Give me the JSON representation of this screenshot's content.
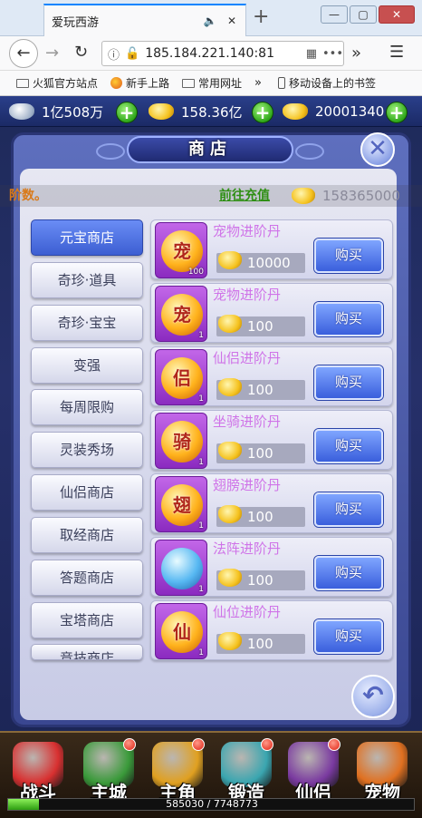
{
  "browser": {
    "tab_title": "爱玩西游",
    "url": "185.184.221.140:81",
    "bookmarks": [
      "火狐官方站点",
      "新手上路",
      "常用网址",
      "移动设备上的书签"
    ],
    "more_label": "»",
    "window_buttons": [
      "—",
      "▢",
      "✕"
    ]
  },
  "resources": [
    {
      "icon": "silver-ingot-icon",
      "value": "1亿508万"
    },
    {
      "icon": "gold-ingot-icon",
      "value": "158.36亿"
    },
    {
      "icon": "gold-ingot-pile-icon",
      "value": "20001340"
    }
  ],
  "shop": {
    "title": "商店",
    "notice": "阶数。",
    "recharge_link": "前往充值",
    "balance": "158365000"
  },
  "categories": [
    "元宝商店",
    "奇珍·道具",
    "奇珍·宝宝",
    "变强",
    "每周限购",
    "灵装秀场",
    "仙侣商店",
    "取经商店",
    "答题商店",
    "宝塔商店",
    "竞技商店"
  ],
  "active_category": 0,
  "items": [
    {
      "name": "宠物进阶丹",
      "glyph": "宠",
      "qty": "100",
      "price": "10000",
      "buy": "购买"
    },
    {
      "name": "宠物进阶丹",
      "glyph": "宠",
      "qty": "1",
      "price": "100",
      "buy": "购买"
    },
    {
      "name": "仙侣进阶丹",
      "glyph": "侣",
      "qty": "1",
      "price": "100",
      "buy": "购买"
    },
    {
      "name": "坐骑进阶丹",
      "glyph": "骑",
      "qty": "1",
      "price": "100",
      "buy": "购买"
    },
    {
      "name": "翅膀进阶丹",
      "glyph": "翅",
      "qty": "1",
      "price": "100",
      "buy": "购买"
    },
    {
      "name": "法阵进阶丹",
      "glyph": "",
      "qty": "1",
      "price": "100",
      "buy": "购买"
    },
    {
      "name": "仙位进阶丹",
      "glyph": "仙",
      "qty": "1",
      "price": "100",
      "buy": "购买"
    }
  ],
  "bottom_nav": [
    {
      "label": "战斗",
      "color": "#d83030",
      "dot": false
    },
    {
      "label": "主城",
      "color": "#3a9a3a",
      "dot": true
    },
    {
      "label": "主角",
      "color": "#e0a020",
      "dot": true
    },
    {
      "label": "锻造",
      "color": "#3aa6b0",
      "dot": true
    },
    {
      "label": "仙侣",
      "color": "#7a3aa0",
      "dot": true
    },
    {
      "label": "宠物",
      "color": "#e07020",
      "dot": false
    }
  ],
  "exp": {
    "text": "585030 / 7748773",
    "fraction": 0.0755
  },
  "colors": {
    "accent_blue": "#3c5ed2",
    "item_name": "#cf74e8",
    "recharge_green": "#2f8f14",
    "notice_orange": "#d97a1a"
  }
}
